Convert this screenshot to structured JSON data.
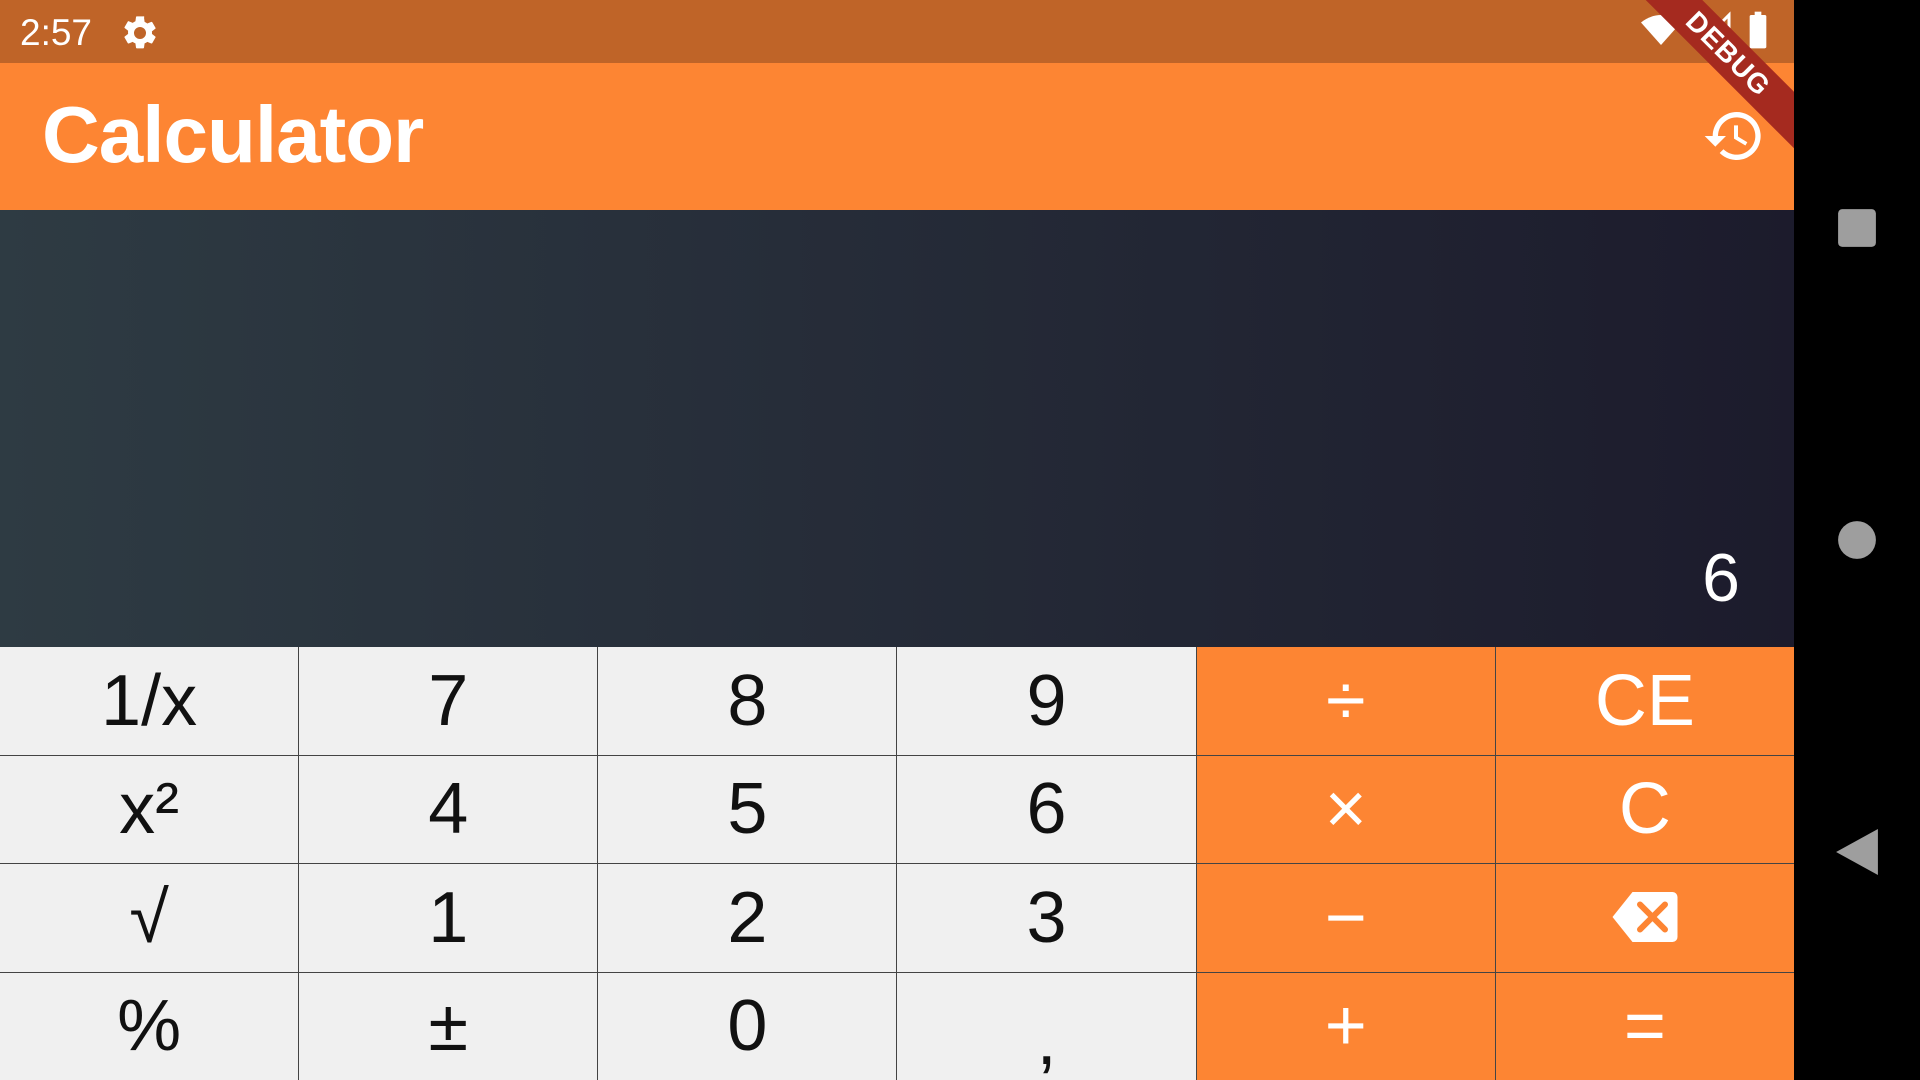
{
  "status_bar": {
    "time": "2:57",
    "icons": [
      "gear-icon",
      "wifi-icon",
      "signal-icon",
      "battery-icon"
    ]
  },
  "app_bar": {
    "title": "Calculator",
    "history_icon": "history-icon"
  },
  "debug_banner": {
    "label": "DEBUG"
  },
  "display": {
    "value": "6"
  },
  "keypad": {
    "rows": [
      [
        {
          "label": "1/x",
          "type": "function"
        },
        {
          "label": "7",
          "type": "digit"
        },
        {
          "label": "8",
          "type": "digit"
        },
        {
          "label": "9",
          "type": "digit"
        },
        {
          "label": "÷",
          "type": "operator"
        },
        {
          "label": "CE",
          "type": "operator"
        }
      ],
      [
        {
          "label": "x²",
          "type": "function"
        },
        {
          "label": "4",
          "type": "digit"
        },
        {
          "label": "5",
          "type": "digit"
        },
        {
          "label": "6",
          "type": "digit"
        },
        {
          "label": "×",
          "type": "operator"
        },
        {
          "label": "C",
          "type": "operator"
        }
      ],
      [
        {
          "label": "√",
          "type": "function"
        },
        {
          "label": "1",
          "type": "digit"
        },
        {
          "label": "2",
          "type": "digit"
        },
        {
          "label": "3",
          "type": "digit"
        },
        {
          "label": "−",
          "type": "operator"
        },
        {
          "label": "",
          "type": "operator",
          "icon": "backspace-icon"
        }
      ],
      [
        {
          "label": "%",
          "type": "function"
        },
        {
          "label": "±",
          "type": "function"
        },
        {
          "label": "0",
          "type": "digit"
        },
        {
          "label": ",",
          "type": "digit"
        },
        {
          "label": "+",
          "type": "operator"
        },
        {
          "label": "=",
          "type": "operator"
        }
      ]
    ]
  },
  "nav_bar": {
    "buttons": [
      "recents-icon",
      "home-icon",
      "back-icon"
    ]
  },
  "colors": {
    "status_bar": "#bf6428",
    "accent": "#fd8533",
    "display_start": "#2e3b43",
    "display_end": "#1c1b2c",
    "key_light": "#f0f0f0",
    "debug_ribbon": "#a52a1f"
  }
}
